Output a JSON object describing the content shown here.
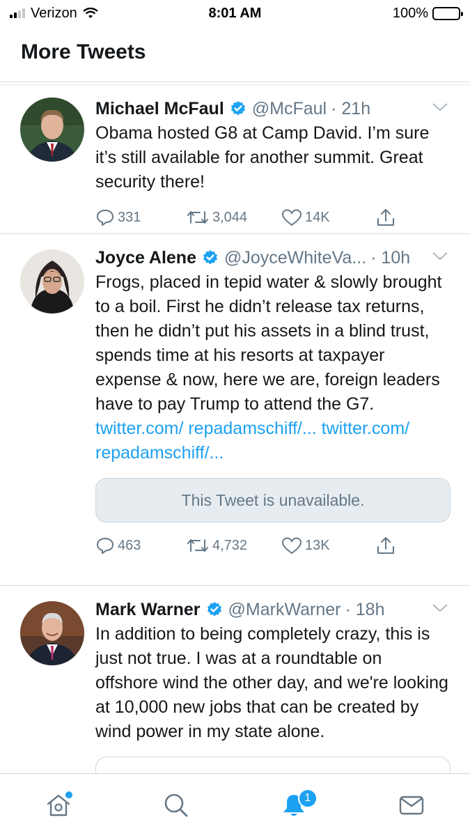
{
  "status_bar": {
    "carrier": "Verizon",
    "time": "8:01 AM",
    "battery": "100%"
  },
  "header": {
    "title": "More Tweets"
  },
  "tweets": [
    {
      "name": "Michael McFaul",
      "handle": "@McFaul",
      "time": "· 21h",
      "text": "Obama hosted G8 at Camp David. I’m sure it’s still available for another summit. Great security there!",
      "replies": "331",
      "retweets": "3,044",
      "likes": "14K"
    },
    {
      "name": "Joyce Alene",
      "handle": "@JoyceWhiteVa...",
      "time": "· 10h",
      "text": "Frogs, placed in tepid water & slowly brought to a boil. First he didn’t release tax returns, then he didn’t put his assets in a blind trust, spends  time at his resorts at taxpayer expense & now, here we are, foreign leaders have to pay Trump to attend the G7.",
      "link1": "twitter.com/ repadamschiff/...",
      "link2": "twitter.com/ repadamschiff/...",
      "unavailable": "This Tweet is unavailable.",
      "replies": "463",
      "retweets": "4,732",
      "likes": "13K"
    },
    {
      "name": "Mark Warner",
      "handle": "@MarkWarner",
      "time": "· 18h",
      "text": "In addition to being completely crazy, this is just not true. I was at a roundtable on offshore wind the other day, and we're looking at 10,000 new jobs that can be created by wind power in my state alone."
    }
  ],
  "tabbar": {
    "notifications_badge": "1"
  },
  "colors": {
    "accent": "#1da1f2",
    "secondary_text": "#657786",
    "primary_text": "#14171a"
  }
}
